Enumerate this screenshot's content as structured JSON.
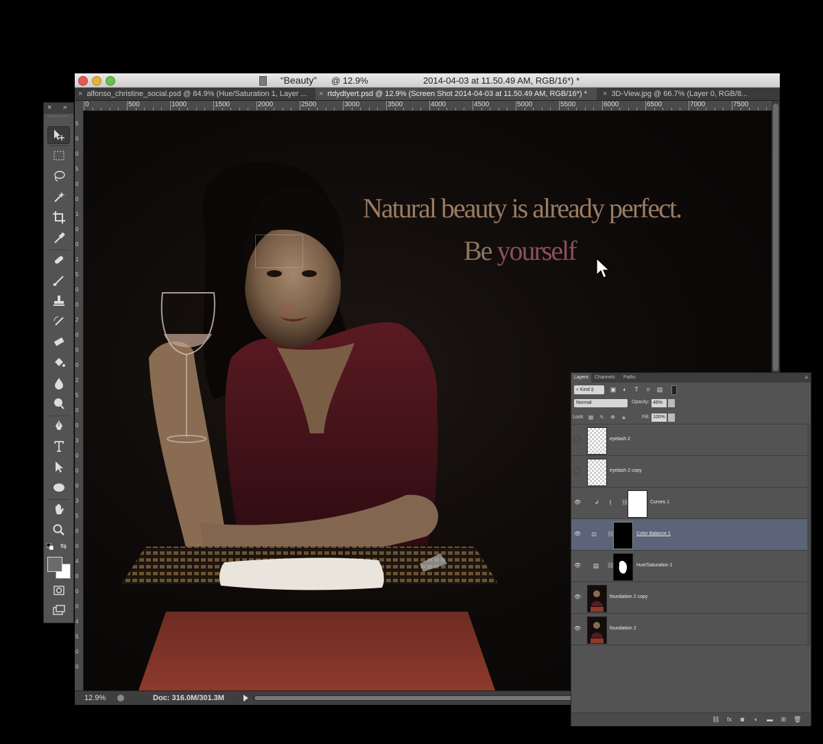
{
  "window": {
    "title_name": "“Beauty”",
    "title_zoom": "@ 12.9%",
    "title_info": "2014-04-03 at 11.50.49 AM, RGB/16*) *"
  },
  "tabs": [
    {
      "label": "alfonso_christine_social.psd @ 84.9% (Hue/Saturation 1, Layer ...",
      "active": false
    },
    {
      "label": "rtdydtyert.psd @ 12.9% (Screen Shot 2014-04-03 at 11.50.49 AM, RGB/16*) *",
      "active": true
    },
    {
      "label": "3D-View.jpg @ 66.7% (Layer 0, RGB/8...",
      "active": false
    }
  ],
  "ruler": {
    "top_labels": [
      "0",
      "500",
      "1000",
      "1500",
      "2000",
      "2500",
      "3000",
      "3500",
      "4000",
      "4500",
      "5000",
      "5500",
      "6000",
      "6500",
      "7000",
      "7500"
    ],
    "left_labels": [
      "5",
      "0",
      "0",
      "5",
      "0",
      "0",
      "1",
      "0",
      "0",
      "1",
      "5",
      "0",
      "0",
      "2",
      "0",
      "0",
      "0",
      "2",
      "5",
      "0",
      "0",
      "3",
      "0",
      "0",
      "0",
      "3",
      "5",
      "0",
      "0",
      "4",
      "0",
      "0",
      "0",
      "4",
      "5",
      "0",
      "0"
    ]
  },
  "canvas": {
    "headline": "Natural beauty is already perfect.",
    "sub_a": "Be ",
    "sub_b": "yourself",
    "text_color_headline": "#9a7b63",
    "text_color_accent": "#8b4f5c"
  },
  "status": {
    "zoom": "12.9%",
    "doc": "Doc: 316.0M/301.3M"
  },
  "tools": [
    {
      "name": "move-tool-icon",
      "selected": true
    },
    {
      "name": "marquee-tool-icon"
    },
    {
      "name": "lasso-tool-icon"
    },
    {
      "name": "magic-wand-tool-icon"
    },
    {
      "name": "crop-tool-icon"
    },
    {
      "name": "eyedropper-tool-icon"
    },
    {
      "name": "healing-brush-tool-icon"
    },
    {
      "name": "brush-tool-icon"
    },
    {
      "name": "clone-stamp-tool-icon"
    },
    {
      "name": "history-brush-tool-icon"
    },
    {
      "name": "eraser-tool-icon"
    },
    {
      "name": "paint-bucket-tool-icon"
    },
    {
      "name": "blur-tool-icon"
    },
    {
      "name": "dodge-tool-icon"
    },
    {
      "name": "pen-tool-icon"
    },
    {
      "name": "type-tool-icon"
    },
    {
      "name": "path-selection-tool-icon"
    },
    {
      "name": "ellipse-tool-icon"
    },
    {
      "name": "hand-tool-icon"
    },
    {
      "name": "zoom-tool-icon"
    }
  ],
  "layers_panel": {
    "tabs": [
      "Layers",
      "Channels",
      "Paths"
    ],
    "kind": "Kind",
    "blend_mode": "Normal",
    "opacity_label": "Opacity:",
    "opacity": "48%",
    "lock_label": "Lock:",
    "fill_label": "Fill:",
    "fill": "100%",
    "layers": [
      {
        "name": "eyelash 2",
        "visible": false,
        "thumb": "transparent"
      },
      {
        "name": "eyelash 2 copy",
        "visible": false,
        "thumb": "transparent"
      },
      {
        "name": "Curves 1",
        "visible": true,
        "thumb": "curves",
        "mask": "white",
        "clipped": true
      },
      {
        "name": "Color Balance 1",
        "visible": true,
        "thumb": "balance",
        "mask": "black",
        "selected": true
      },
      {
        "name": "Hue/Saturation 1",
        "visible": true,
        "thumb": "huesat",
        "mask": "blob"
      },
      {
        "name": "foundation 2 copy",
        "visible": true,
        "thumb": "photo"
      },
      {
        "name": "foundation 2",
        "visible": true,
        "thumb": "photo"
      }
    ]
  }
}
